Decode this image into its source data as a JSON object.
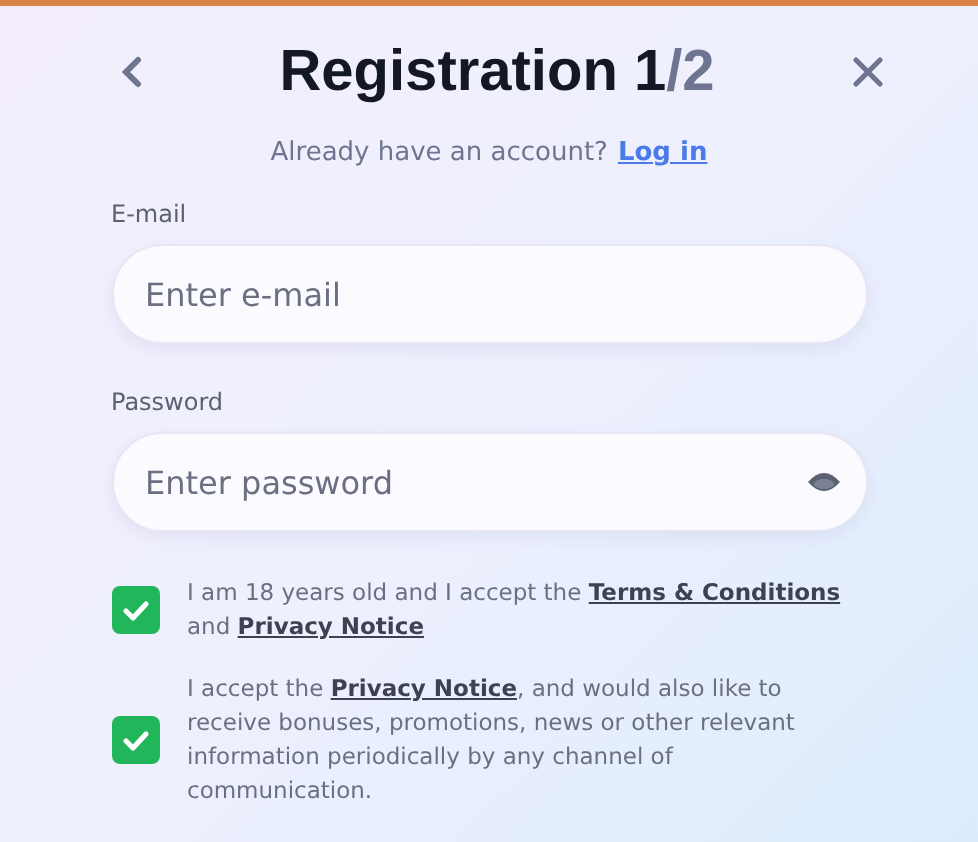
{
  "header": {
    "title": "Registration 1",
    "step_total": "/2"
  },
  "login_prompt": {
    "text": "Already have an account?",
    "link": "Log in"
  },
  "fields": [
    {
      "label": "E-mail",
      "placeholder": "Enter e-mail",
      "kind": "text"
    },
    {
      "label": "Password",
      "placeholder": "Enter password",
      "kind": "password"
    }
  ],
  "consents": [
    {
      "checked": true,
      "parts": [
        {
          "kind": "text",
          "text": "I am 18 years old and I accept the "
        },
        {
          "kind": "link",
          "text": "Terms & Conditions"
        },
        {
          "kind": "text",
          "text": " and "
        },
        {
          "kind": "link",
          "text": "Privacy Notice"
        }
      ]
    },
    {
      "checked": true,
      "parts": [
        {
          "kind": "text",
          "text": "I accept the "
        },
        {
          "kind": "link",
          "text": "Privacy Notice"
        },
        {
          "kind": "text",
          "text": ", and would also like to receive bonuses, promotions, news or other relevant information periodically by any channel of communication."
        }
      ]
    }
  ]
}
